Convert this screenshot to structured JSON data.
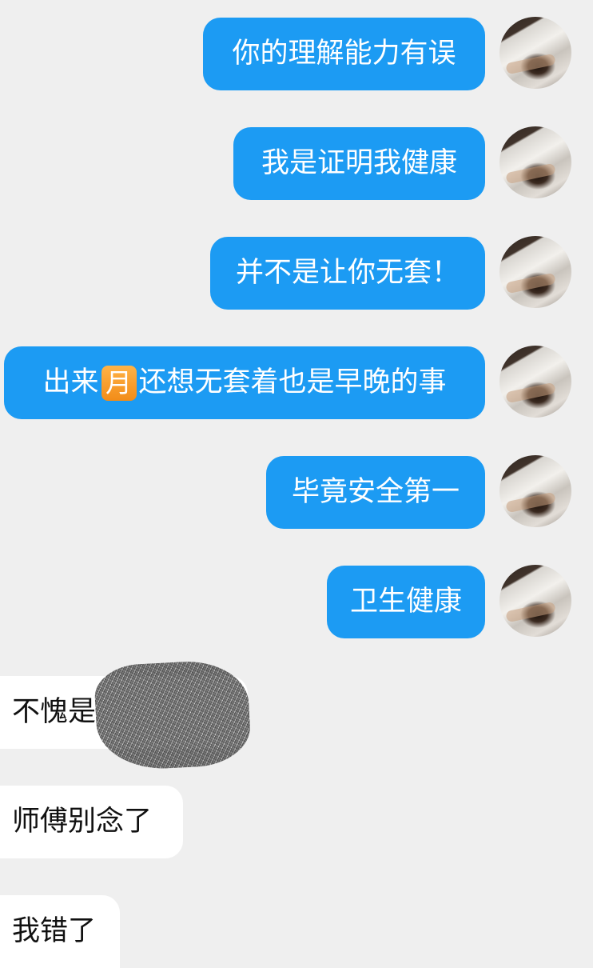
{
  "conversation": {
    "outgoing": [
      {
        "text": "你的理解能力有误"
      },
      {
        "text": "我是证明我健康"
      },
      {
        "text": "并不是让你无套！"
      },
      {
        "text_before": "出来",
        "emoji": "月",
        "text_after": "还想无套着也是早晚的事"
      },
      {
        "text": "毕竟安全第一"
      },
      {
        "text": "卫生健康"
      }
    ],
    "incoming": [
      {
        "text": "不愧是"
      },
      {
        "text": "师傅别念了"
      },
      {
        "text": "我错了"
      }
    ]
  }
}
